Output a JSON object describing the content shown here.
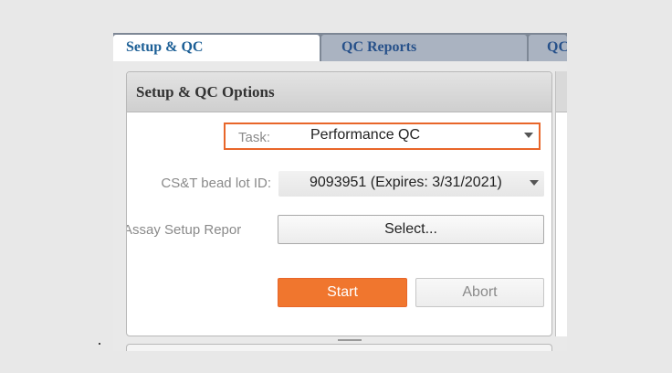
{
  "tabs": [
    {
      "label": "Setup & QC",
      "active": true
    },
    {
      "label": "QC Reports",
      "active": false
    },
    {
      "label": "QC",
      "active": false
    }
  ],
  "panel": {
    "title": "Setup & QC Options"
  },
  "form": {
    "task_label": "Task:",
    "task_value": "Performance QC",
    "bead_lot_label": "CS&T bead lot ID:",
    "bead_lot_value": "9093951 (Expires: 3/31/2021)",
    "assay_label": "Assay Setup Repor",
    "select_button": "Select..."
  },
  "actions": {
    "start_label": "Start",
    "abort_label": "Abort"
  },
  "colors": {
    "accent": "#f0762e",
    "highlight_border": "#e8662a",
    "tab_text": "#1c5f96"
  }
}
